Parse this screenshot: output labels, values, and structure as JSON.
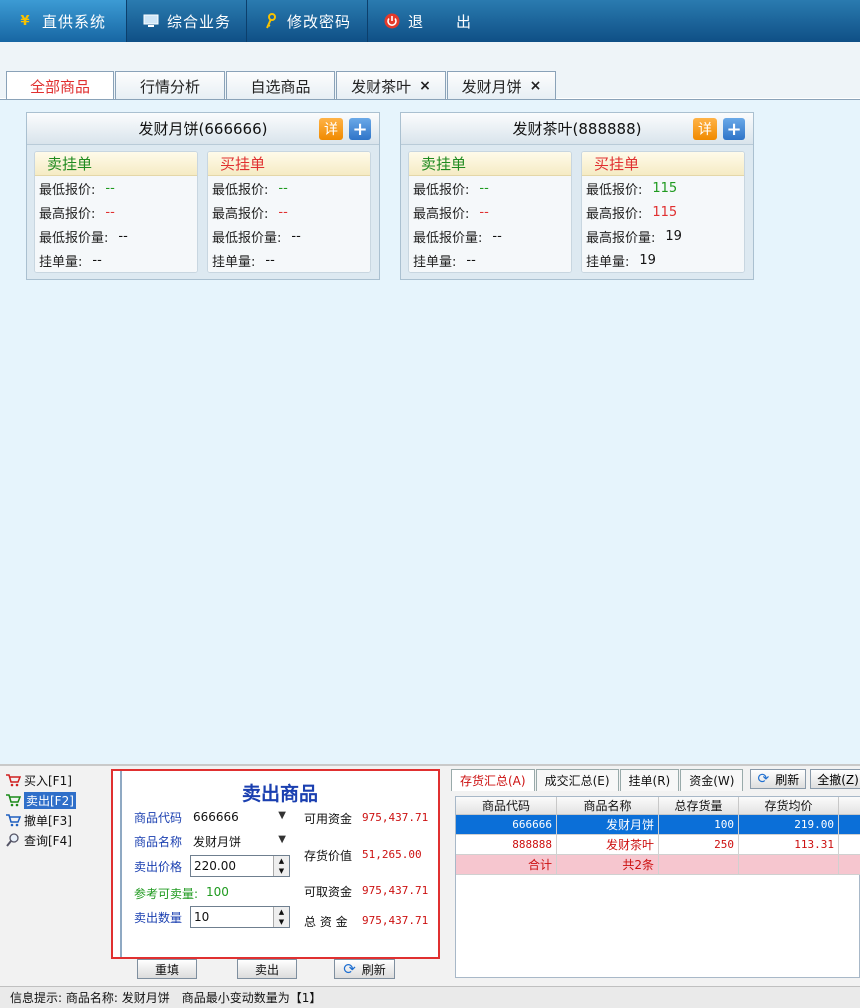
{
  "nav": {
    "items": [
      {
        "label": "直供系统",
        "icon": "yen-icon"
      },
      {
        "label": "综合业务",
        "icon": "monitor-icon"
      },
      {
        "label": "修改密码",
        "icon": "key-icon"
      },
      {
        "label": "退　　出",
        "icon": "power-icon"
      }
    ]
  },
  "tabs": [
    {
      "label": "全部商品"
    },
    {
      "label": "行情分析"
    },
    {
      "label": "自选商品"
    },
    {
      "label": "发财茶叶",
      "close": "×"
    },
    {
      "label": "发财月饼",
      "close": "×"
    }
  ],
  "cards": [
    {
      "title": "发财月饼(666666)",
      "detail_label": "详",
      "add_label": "+",
      "sell": {
        "title": "卖挂单",
        "rows": [
          {
            "k": "最低报价:",
            "v": "--"
          },
          {
            "k": "最高报价:",
            "v": "--"
          },
          {
            "k": "最低报价量:",
            "v": "--"
          },
          {
            "k": "挂单量:",
            "v": "--"
          }
        ]
      },
      "buy": {
        "title": "买挂单",
        "rows": [
          {
            "k": "最低报价:",
            "v": "--"
          },
          {
            "k": "最高报价:",
            "v": "--"
          },
          {
            "k": "最低报价量:",
            "v": "--"
          },
          {
            "k": "挂单量:",
            "v": "--"
          }
        ]
      }
    },
    {
      "title": "发财茶叶(888888)",
      "detail_label": "详",
      "add_label": "+",
      "sell": {
        "title": "卖挂单",
        "rows": [
          {
            "k": "最低报价:",
            "v": "--"
          },
          {
            "k": "最高报价:",
            "v": "--"
          },
          {
            "k": "最低报价量:",
            "v": "--"
          },
          {
            "k": "挂单量:",
            "v": "--"
          }
        ]
      },
      "buy": {
        "title": "买挂单",
        "rows": [
          {
            "k": "最低报价:",
            "v": "115"
          },
          {
            "k": "最高报价:",
            "v": "115"
          },
          {
            "k": "最高报价量:",
            "v": "19"
          },
          {
            "k": "挂单量:",
            "v": "19"
          }
        ]
      }
    }
  ],
  "side": {
    "items": [
      {
        "label": "买入[F1]"
      },
      {
        "label": "卖出[F2]"
      },
      {
        "label": "撤单[F3]"
      },
      {
        "label": "查询[F4]"
      }
    ]
  },
  "form": {
    "title": "卖出商品",
    "code_label": "商品代码",
    "code_value": "666666",
    "name_label": "商品名称",
    "name_value": "发财月饼",
    "price_label": "卖出价格",
    "price_value": "220.00",
    "ref_label": "参考可卖量:",
    "ref_value": "100",
    "qty_label": "卖出数量",
    "qty_value": "10",
    "avail_label": "可用资金",
    "avail_value": "975,437.71",
    "stock_label": "存货价值",
    "stock_value": "51,265.00",
    "withdraw_label": "可取资金",
    "withdraw_value": "975,437.71",
    "total_label": "总 资 金",
    "total_value": "975,437.71",
    "reset_label": "重填",
    "sell_label": "卖出",
    "refresh_label": "刷新"
  },
  "right": {
    "tabs": [
      {
        "label": "存货汇总(A)"
      },
      {
        "label": "成交汇总(E)"
      },
      {
        "label": "挂单(R)"
      },
      {
        "label": "资金(W)"
      }
    ],
    "refresh_label": "刷新",
    "cancel_all_label": "全撤(Z)",
    "columns": [
      "商品代码",
      "商品名称",
      "总存货量",
      "存货均价"
    ],
    "rows": [
      [
        "666666",
        "发财月饼",
        "100",
        "219.00"
      ],
      [
        "888888",
        "发财茶叶",
        "250",
        "113.31"
      ]
    ],
    "sum_row": [
      "合计",
      "共2条",
      "",
      ""
    ]
  },
  "status": {
    "text": "信息提示: 商品名称: 发财月饼　商品最小变动数量为【1】"
  },
  "colors": {
    "nav_bg": "#0f4f86",
    "accent_red": "#e03030",
    "sell_green": "#1f8a1f",
    "selected_row": "#0b6fd8",
    "sum_row": "#f6c6cf"
  }
}
